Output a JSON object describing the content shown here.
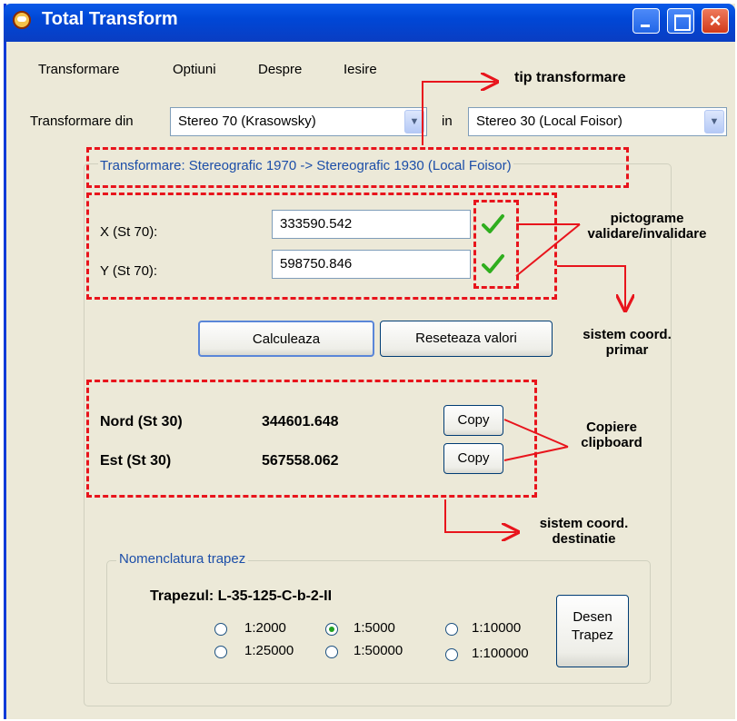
{
  "window": {
    "title": "Total Transform"
  },
  "menu": [
    "Transformare",
    "Optiuni",
    "Despre",
    "Iesire"
  ],
  "transform": {
    "from_label": "Transformare din",
    "from_value": "Stereo 70 (Krasowsky)",
    "in_label": "in",
    "to_value": "Stereo 30 (Local Foisor)",
    "description": "Transformare: Stereografic 1970 -> Stereografic 1930 (Local Foisor)"
  },
  "input": {
    "x_label": "X (St 70):",
    "x_value": "333590.542",
    "y_label": "Y (St 70):",
    "y_value": "598750.846",
    "validation_icon": "checkmark-icon"
  },
  "buttons": {
    "calculate": "Calculeaza",
    "reset": "Reseteaza valori",
    "copy": "Copy",
    "draw": "Desen Trapez"
  },
  "output": {
    "nord_label": "Nord (St 30)",
    "nord_value": "344601.648",
    "est_label": "Est (St 30)",
    "est_value": "567558.062"
  },
  "nomenclature": {
    "group_label": "Nomenclatura trapez",
    "trapez_label": "Trapezul: L-35-125-C-b-2-II",
    "scales": [
      "1:2000",
      "1:5000",
      "1:10000",
      "1:25000",
      "1:50000",
      "1:100000"
    ],
    "selected": "1:5000"
  },
  "annotations": {
    "tip": "tip transformare",
    "pictograme": "pictograme validare/invalidare",
    "primar": "sistem coord. primar",
    "copiere": "Copiere clipboard",
    "destinatie": "sistem coord. destinatie"
  },
  "colors": {
    "annotation_red": "#e8141c",
    "title_blue": "#0047d6",
    "check_green": "#2fae1e"
  }
}
